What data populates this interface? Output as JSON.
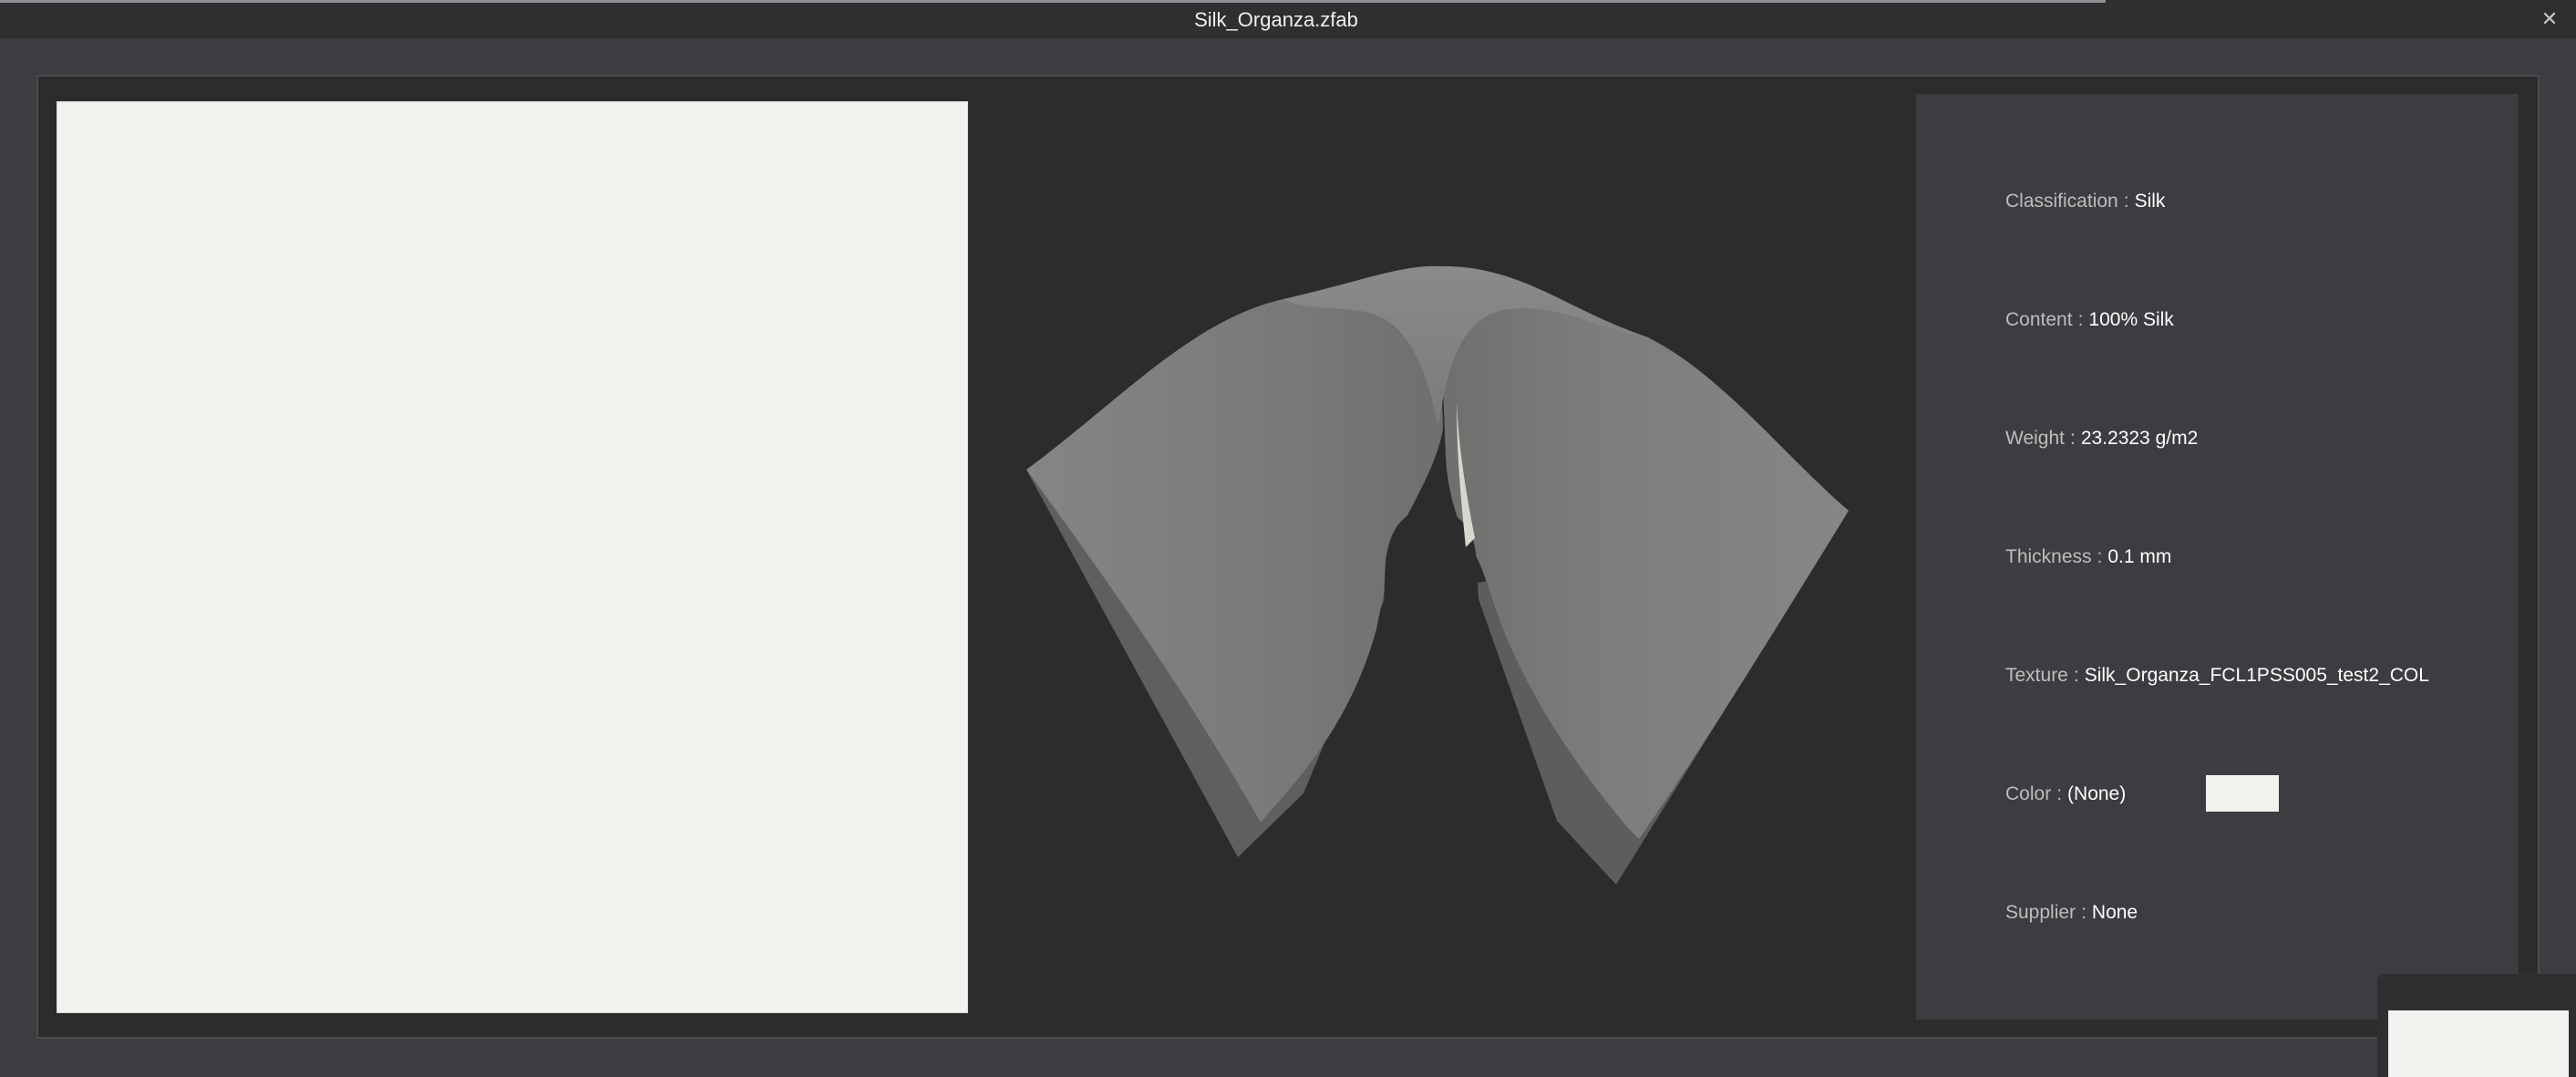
{
  "window": {
    "title": "Silk_Organza.zfab",
    "close_glyph": "✕"
  },
  "colors": {
    "texture": "#f1f2ee",
    "fabric_3d": "#7e7e7c",
    "background": "#2c2c2c",
    "panel": "#3c3d40"
  },
  "icons": {
    "close": "close-icon"
  },
  "info": {
    "classification": {
      "label": "Classification",
      "value": "Silk"
    },
    "content": {
      "label": "Content",
      "value": "100% Silk"
    },
    "weight": {
      "label": "Weight",
      "value": "23.2323 g/m2"
    },
    "thickness": {
      "label": "Thickness",
      "value": "0.1 mm"
    },
    "texture": {
      "label": "Texture",
      "value": "Silk_Organza_FCL1PSS005_test2_COL"
    },
    "color": {
      "label": "Color",
      "value": "(None)"
    },
    "supplier": {
      "label": "Supplier",
      "value": "None"
    },
    "separator": ":"
  }
}
